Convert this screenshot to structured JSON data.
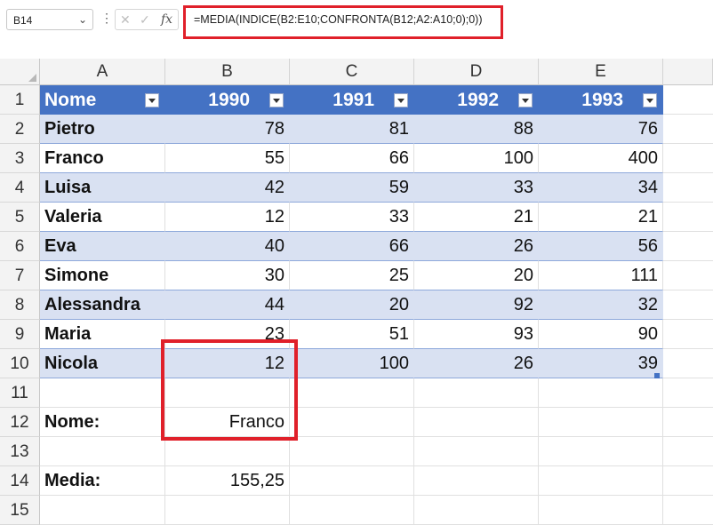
{
  "formula_bar": {
    "cell_ref": "B14",
    "fx": "fx",
    "formula": "=MEDIA(INDICE(B2:E10;CONFRONTA(B12;A2:A10;0);0))"
  },
  "columns": [
    "A",
    "B",
    "C",
    "D",
    "E"
  ],
  "rows": [
    "1",
    "2",
    "3",
    "4",
    "5",
    "6",
    "7",
    "8",
    "9",
    "10",
    "11",
    "12",
    "13",
    "14",
    "15"
  ],
  "table": {
    "headers": [
      "Nome",
      "1990",
      "1991",
      "1992",
      "1993"
    ],
    "data": [
      [
        "Pietro",
        "78",
        "81",
        "88",
        "76"
      ],
      [
        "Franco",
        "55",
        "66",
        "100",
        "400"
      ],
      [
        "Luisa",
        "42",
        "59",
        "33",
        "34"
      ],
      [
        "Valeria",
        "12",
        "33",
        "21",
        "21"
      ],
      [
        "Eva",
        "40",
        "66",
        "26",
        "56"
      ],
      [
        "Simone",
        "30",
        "25",
        "20",
        "111"
      ],
      [
        "Alessandra",
        "44",
        "20",
        "92",
        "32"
      ],
      [
        "Maria",
        "23",
        "51",
        "93",
        "90"
      ],
      [
        "Nicola",
        "12",
        "100",
        "26",
        "39"
      ]
    ]
  },
  "lookup": {
    "nome_label": "Nome:",
    "nome_value": "Franco",
    "media_label": "Media:",
    "media_value": "155,25"
  },
  "colors": {
    "header_blue": "#4472c4",
    "band": "#d9e1f2",
    "highlight_red": "#e0202a"
  }
}
